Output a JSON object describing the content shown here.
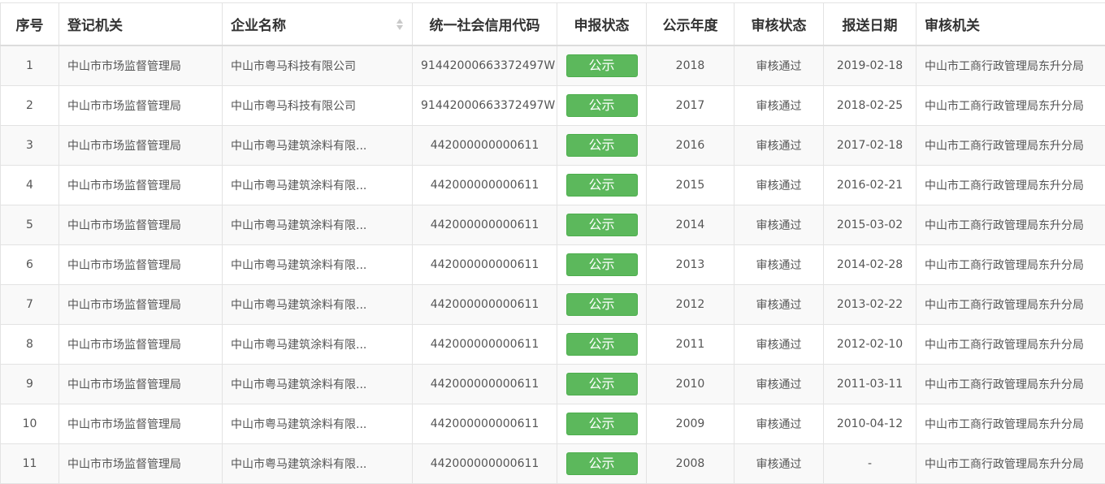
{
  "headers": {
    "index": "序号",
    "authority": "登记机关",
    "company": "企业名称",
    "credit_code": "统一社会信用代码",
    "report_status": "申报状态",
    "year": "公示年度",
    "review_status": "审核状态",
    "submit_date": "报送日期",
    "review_authority": "审核机关"
  },
  "colors": {
    "badge_green": "#5cb85c",
    "stripe": "#f9f9f9"
  },
  "rows": [
    {
      "index": "1",
      "authority": "中山市市场监督管理局",
      "company": "中山市粤马科技有限公司",
      "credit_code": "91442000663372497W",
      "report_status": "公示",
      "year": "2018",
      "review_status": "审核通过",
      "submit_date": "2019-02-18",
      "review_authority": "中山市工商行政管理局东升分局"
    },
    {
      "index": "2",
      "authority": "中山市市场监督管理局",
      "company": "中山市粤马科技有限公司",
      "credit_code": "91442000663372497W",
      "report_status": "公示",
      "year": "2017",
      "review_status": "审核通过",
      "submit_date": "2018-02-25",
      "review_authority": "中山市工商行政管理局东升分局"
    },
    {
      "index": "3",
      "authority": "中山市市场监督管理局",
      "company": "中山市粤马建筑涂料有限...",
      "credit_code": "442000000000611",
      "report_status": "公示",
      "year": "2016",
      "review_status": "审核通过",
      "submit_date": "2017-02-18",
      "review_authority": "中山市工商行政管理局东升分局"
    },
    {
      "index": "4",
      "authority": "中山市市场监督管理局",
      "company": "中山市粤马建筑涂料有限...",
      "credit_code": "442000000000611",
      "report_status": "公示",
      "year": "2015",
      "review_status": "审核通过",
      "submit_date": "2016-02-21",
      "review_authority": "中山市工商行政管理局东升分局"
    },
    {
      "index": "5",
      "authority": "中山市市场监督管理局",
      "company": "中山市粤马建筑涂料有限...",
      "credit_code": "442000000000611",
      "report_status": "公示",
      "year": "2014",
      "review_status": "审核通过",
      "submit_date": "2015-03-02",
      "review_authority": "中山市工商行政管理局东升分局"
    },
    {
      "index": "6",
      "authority": "中山市市场监督管理局",
      "company": "中山市粤马建筑涂料有限...",
      "credit_code": "442000000000611",
      "report_status": "公示",
      "year": "2013",
      "review_status": "审核通过",
      "submit_date": "2014-02-28",
      "review_authority": "中山市工商行政管理局东升分局"
    },
    {
      "index": "7",
      "authority": "中山市市场监督管理局",
      "company": "中山市粤马建筑涂料有限...",
      "credit_code": "442000000000611",
      "report_status": "公示",
      "year": "2012",
      "review_status": "审核通过",
      "submit_date": "2013-02-22",
      "review_authority": "中山市工商行政管理局东升分局"
    },
    {
      "index": "8",
      "authority": "中山市市场监督管理局",
      "company": "中山市粤马建筑涂料有限...",
      "credit_code": "442000000000611",
      "report_status": "公示",
      "year": "2011",
      "review_status": "审核通过",
      "submit_date": "2012-02-10",
      "review_authority": "中山市工商行政管理局东升分局"
    },
    {
      "index": "9",
      "authority": "中山市市场监督管理局",
      "company": "中山市粤马建筑涂料有限...",
      "credit_code": "442000000000611",
      "report_status": "公示",
      "year": "2010",
      "review_status": "审核通过",
      "submit_date": "2011-03-11",
      "review_authority": "中山市工商行政管理局东升分局"
    },
    {
      "index": "10",
      "authority": "中山市市场监督管理局",
      "company": "中山市粤马建筑涂料有限...",
      "credit_code": "442000000000611",
      "report_status": "公示",
      "year": "2009",
      "review_status": "审核通过",
      "submit_date": "2010-04-12",
      "review_authority": "中山市工商行政管理局东升分局"
    },
    {
      "index": "11",
      "authority": "中山市市场监督管理局",
      "company": "中山市粤马建筑涂料有限...",
      "credit_code": "442000000000611",
      "report_status": "公示",
      "year": "2008",
      "review_status": "审核通过",
      "submit_date": "-",
      "review_authority": "中山市工商行政管理局东升分局"
    }
  ]
}
